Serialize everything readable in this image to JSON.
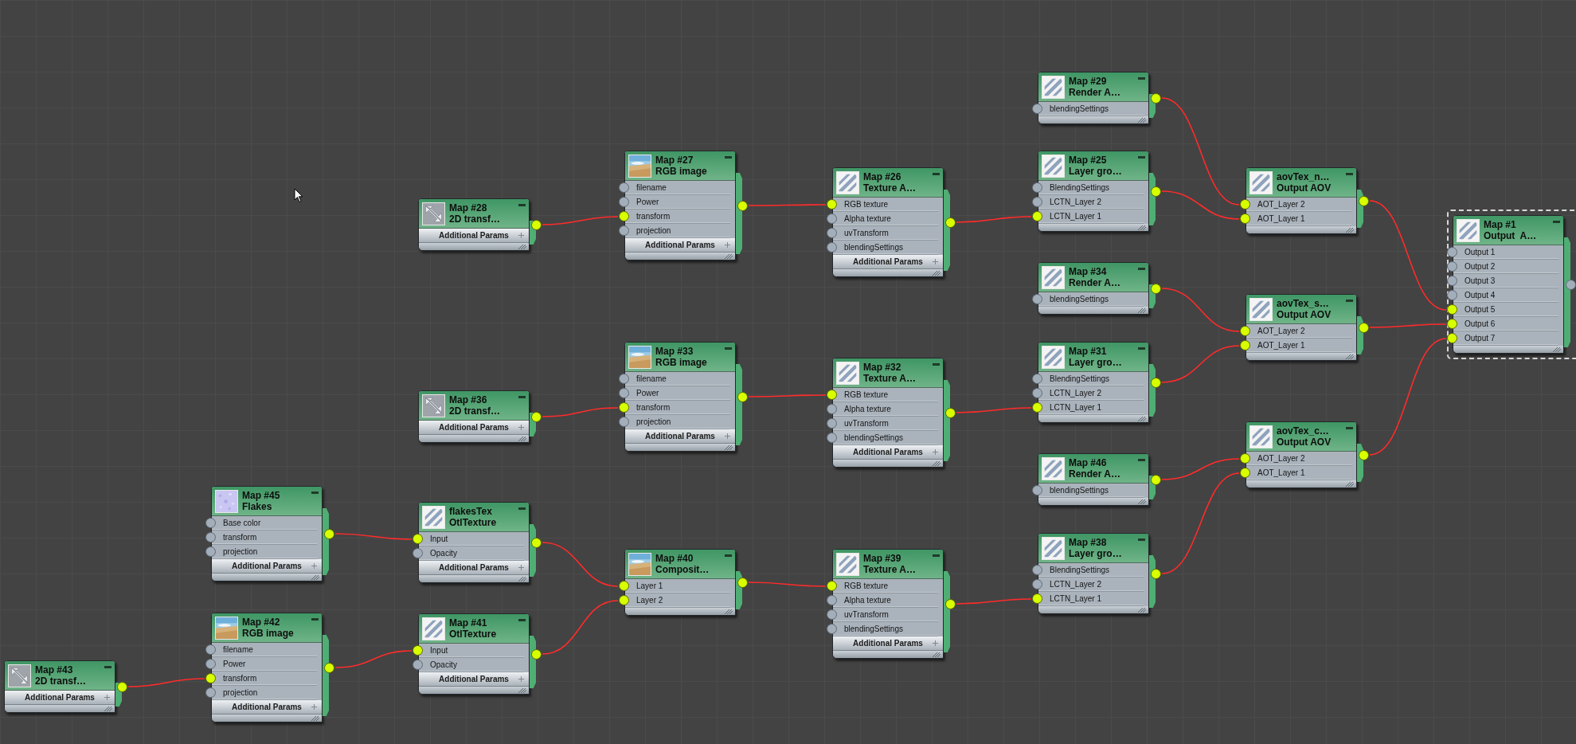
{
  "nodes": [
    {
      "name": "Map #29",
      "type": "Render A…",
      "kind": "stripes",
      "selected": false,
      "output_connected": true,
      "ports": [
        {
          "label": "blendingSettings",
          "connected": false
        }
      ]
    },
    {
      "name": "Map #27",
      "type": "RGB image",
      "selected": false,
      "output_connected": true,
      "ports": [
        {
          "label": "filename",
          "connected": false
        },
        {
          "label": "Power",
          "connected": false
        },
        {
          "label": "transform",
          "connected": true
        },
        {
          "label": "projection",
          "connected": false
        }
      ],
      "footer": "Additional Params"
    },
    {
      "name": "Map #25",
      "type": "Layer gro…",
      "kind": "stripes",
      "selected": false,
      "output_connected": true,
      "ports": [
        {
          "label": "BlendingSettings",
          "connected": false
        },
        {
          "label": "LCTN_Layer 2",
          "connected": false
        },
        {
          "label": "LCTN_Layer 1",
          "connected": true
        }
      ]
    },
    {
      "name": "Map #26",
      "type": "Texture A…",
      "kind": "stripes",
      "selected": false,
      "output_connected": true,
      "ports": [
        {
          "label": "RGB texture",
          "connected": true
        },
        {
          "label": "Alpha texture",
          "connected": false
        },
        {
          "label": "uvTransform",
          "connected": false
        },
        {
          "label": "blendingSettings",
          "connected": false
        }
      ],
      "footer": "Additional Params"
    },
    {
      "name": "aovTex_n…",
      "type": "Output AOV",
      "kind": "stripes",
      "selected": false,
      "output_connected": true,
      "ports": [
        {
          "label": "AOT_Layer 2",
          "connected": true
        },
        {
          "label": "AOT_Layer 1",
          "connected": true
        }
      ]
    },
    {
      "name": "Map #28",
      "type": "2D transf…",
      "kind": "transform",
      "selected": false,
      "output_connected": true,
      "footer": "Additional Params"
    },
    {
      "name": "Map #1",
      "type": "Output  A…",
      "kind": "stripes",
      "selected": true,
      "output_connected": false,
      "ports": [
        {
          "label": "Output 1",
          "connected": false
        },
        {
          "label": "Output 2",
          "connected": false
        },
        {
          "label": "Output 3",
          "connected": false
        },
        {
          "label": "Output 4",
          "connected": false
        },
        {
          "label": "Output 5",
          "connected": true
        },
        {
          "label": "Output 6",
          "connected": true
        },
        {
          "label": "Output 7",
          "connected": true
        }
      ]
    },
    {
      "name": "Map #34",
      "type": "Render A…",
      "kind": "stripes",
      "selected": false,
      "output_connected": true,
      "ports": [
        {
          "label": "blendingSettings",
          "connected": false
        }
      ]
    },
    {
      "name": "aovTex_s…",
      "type": "Output AOV",
      "kind": "stripes",
      "selected": false,
      "output_connected": true,
      "ports": [
        {
          "label": "AOT_Layer 2",
          "connected": true
        },
        {
          "label": "AOT_Layer 1",
          "connected": true
        }
      ]
    },
    {
      "name": "Map #33",
      "type": "RGB image",
      "selected": false,
      "output_connected": true,
      "ports": [
        {
          "label": "filename",
          "connected": false
        },
        {
          "label": "Power",
          "connected": false
        },
        {
          "label": "transform",
          "connected": true
        },
        {
          "label": "projection",
          "connected": false
        }
      ],
      "footer": "Additional Params"
    },
    {
      "name": "Map #31",
      "type": "Layer gro…",
      "kind": "stripes",
      "selected": false,
      "output_connected": true,
      "ports": [
        {
          "label": "BlendingSettings",
          "connected": false
        },
        {
          "label": "LCTN_Layer 2",
          "connected": false
        },
        {
          "label": "LCTN_Layer 1",
          "connected": true
        }
      ]
    },
    {
      "name": "Map #32",
      "type": "Texture A…",
      "kind": "stripes",
      "selected": false,
      "output_connected": true,
      "ports": [
        {
          "label": "RGB texture",
          "connected": true
        },
        {
          "label": "Alpha texture",
          "connected": false
        },
        {
          "label": "uvTransform",
          "connected": false
        },
        {
          "label": "blendingSettings",
          "connected": false
        }
      ],
      "footer": "Additional Params"
    },
    {
      "name": "Map #36",
      "type": "2D transf…",
      "kind": "transform",
      "selected": false,
      "output_connected": true,
      "footer": "Additional Params"
    },
    {
      "name": "aovTex_c…",
      "type": "Output AOV",
      "kind": "stripes",
      "selected": false,
      "output_connected": true,
      "ports": [
        {
          "label": "AOT_Layer 2",
          "connected": true
        },
        {
          "label": "AOT_Layer 1",
          "connected": true
        }
      ]
    },
    {
      "name": "Map #46",
      "type": "Render A…",
      "kind": "stripes",
      "selected": false,
      "output_connected": true,
      "ports": [
        {
          "label": "blendingSettings",
          "connected": false
        }
      ]
    },
    {
      "name": "Map #45",
      "type": "Flakes",
      "kind": "flakes",
      "selected": false,
      "output_connected": true,
      "ports": [
        {
          "label": "Base color",
          "connected": false
        },
        {
          "label": "transform",
          "connected": false
        },
        {
          "label": "projection",
          "connected": false
        }
      ],
      "footer": "Additional Params"
    },
    {
      "name": "flakesTex",
      "type": "OtlTexture",
      "kind": "stripes",
      "selected": false,
      "output_connected": true,
      "ports": [
        {
          "label": "Input",
          "connected": true
        },
        {
          "label": "Opacity",
          "connected": false
        }
      ],
      "footer": "Additional Params"
    },
    {
      "name": "Map #40",
      "type": "Composit…",
      "selected": false,
      "output_connected": true,
      "ports": [
        {
          "label": "Layer 1",
          "connected": true
        },
        {
          "label": "Layer 2",
          "connected": true
        }
      ]
    },
    {
      "name": "Map #39",
      "type": "Texture A…",
      "kind": "stripes",
      "selected": false,
      "output_connected": true,
      "ports": [
        {
          "label": "RGB texture",
          "connected": true
        },
        {
          "label": "Alpha texture",
          "connected": false
        },
        {
          "label": "uvTransform",
          "connected": false
        },
        {
          "label": "blendingSettings",
          "connected": false
        }
      ],
      "footer": "Additional Params"
    },
    {
      "name": "Map #38",
      "type": "Layer gro…",
      "kind": "stripes",
      "selected": false,
      "output_connected": true,
      "ports": [
        {
          "label": "BlendingSettings",
          "connected": false
        },
        {
          "label": "LCTN_Layer 2",
          "connected": false
        },
        {
          "label": "LCTN_Layer 1",
          "connected": true
        }
      ]
    },
    {
      "name": "Map #43",
      "type": "2D transf…",
      "kind": "transform",
      "selected": false,
      "output_connected": true,
      "footer": "Additional Params"
    },
    {
      "name": "Map #42",
      "type": "RGB image",
      "selected": false,
      "output_connected": true,
      "ports": [
        {
          "label": "filename",
          "connected": false
        },
        {
          "label": "Power",
          "connected": false
        },
        {
          "label": "transform",
          "connected": true
        },
        {
          "label": "projection",
          "connected": false
        }
      ],
      "footer": "Additional Params"
    },
    {
      "name": "Map #41",
      "type": "OtlTexture",
      "kind": "stripes",
      "selected": false,
      "output_connected": true,
      "ports": [
        {
          "label": "Input",
          "connected": true
        },
        {
          "label": "Opacity",
          "connected": false
        }
      ],
      "footer": "Additional Params"
    }
  ]
}
